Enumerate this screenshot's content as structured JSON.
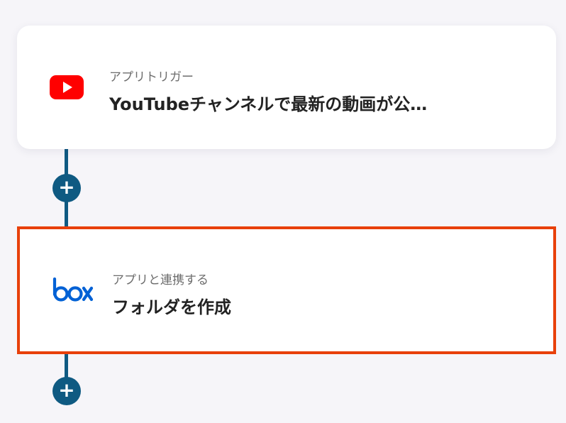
{
  "colors": {
    "background": "#f6f5f9",
    "connector": "#0f5a82",
    "selected_border": "#e8400b",
    "youtube_red": "#ff0000",
    "box_blue": "#0061d5"
  },
  "steps": [
    {
      "icon": "youtube-icon",
      "label": "アプリトリガー",
      "title": "YouTubeチャンネルで最新の動画が公…"
    },
    {
      "icon": "box-logo-icon",
      "label": "アプリと連携する",
      "title": "フォルダを作成"
    }
  ],
  "add_buttons": [
    {
      "symbol": "+"
    },
    {
      "symbol": "+"
    }
  ]
}
